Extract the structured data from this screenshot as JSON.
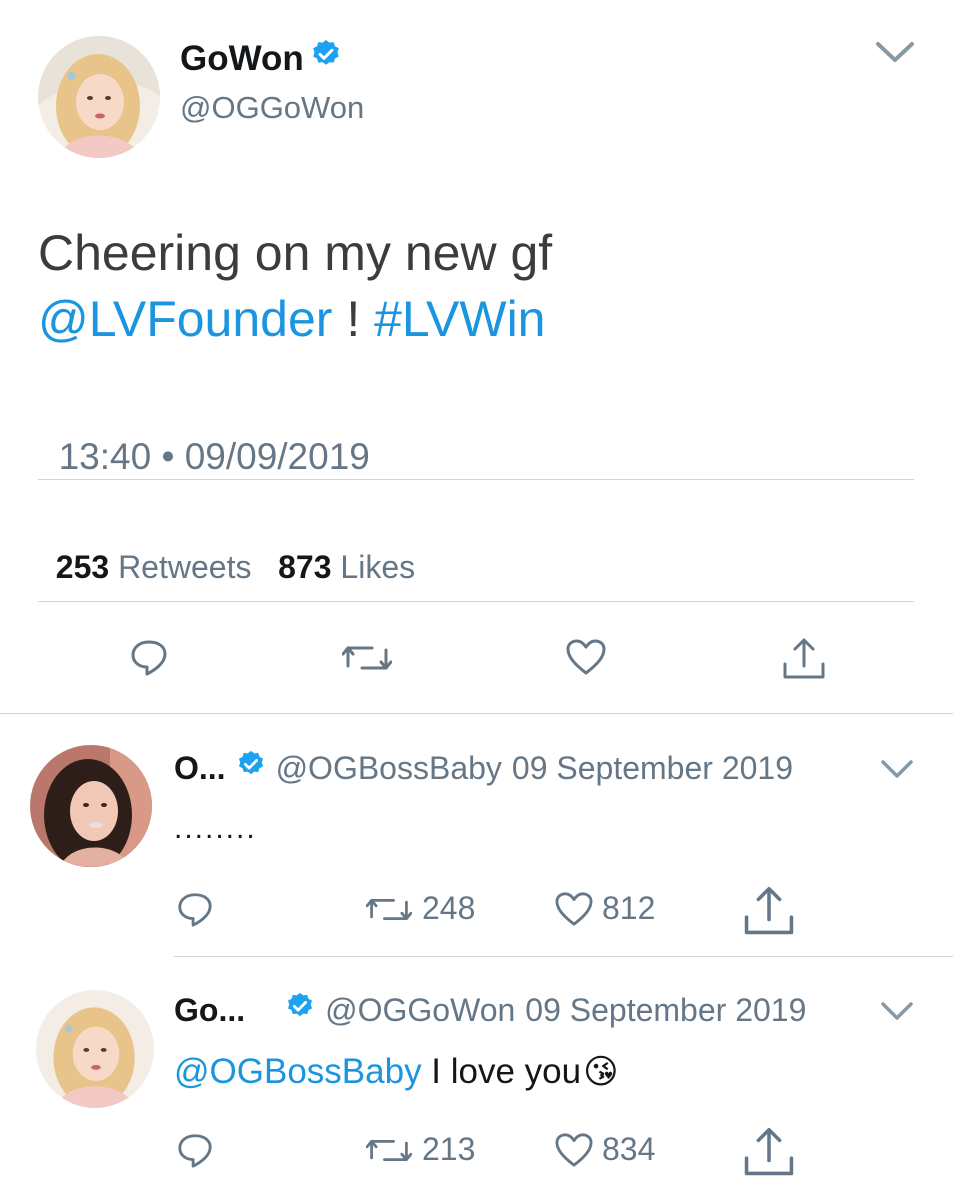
{
  "tweet": {
    "author_name": "GoWon",
    "author_handle": "@OGGoWon",
    "text_line1": "Cheering on my new gf",
    "mention": "@LVFounder",
    "text_after_mention": " ! ",
    "hashtag": "#LVWin",
    "time": "13:40",
    "separator": "•",
    "date": "09/09/2019",
    "retweets_count": "253",
    "retweets_label": "Retweets",
    "likes_count": "873",
    "likes_label": "Likes"
  },
  "replies": [
    {
      "name": "O...",
      "handle": "@OGBossBaby",
      "date": "09 September 2019",
      "text": "........",
      "retweets": "248",
      "likes": "812"
    },
    {
      "name": "Go...",
      "handle": "@OGGoWon",
      "date": "09 September 2019",
      "mention": "@OGBossBaby",
      "text": " I love you",
      "emoji": "😘",
      "retweets": "213",
      "likes": "834"
    }
  ],
  "colors": {
    "link": "#1b95e0",
    "verified": "#1da1f2",
    "secondary_text": "#657786",
    "divider": "#ccd6dd"
  }
}
